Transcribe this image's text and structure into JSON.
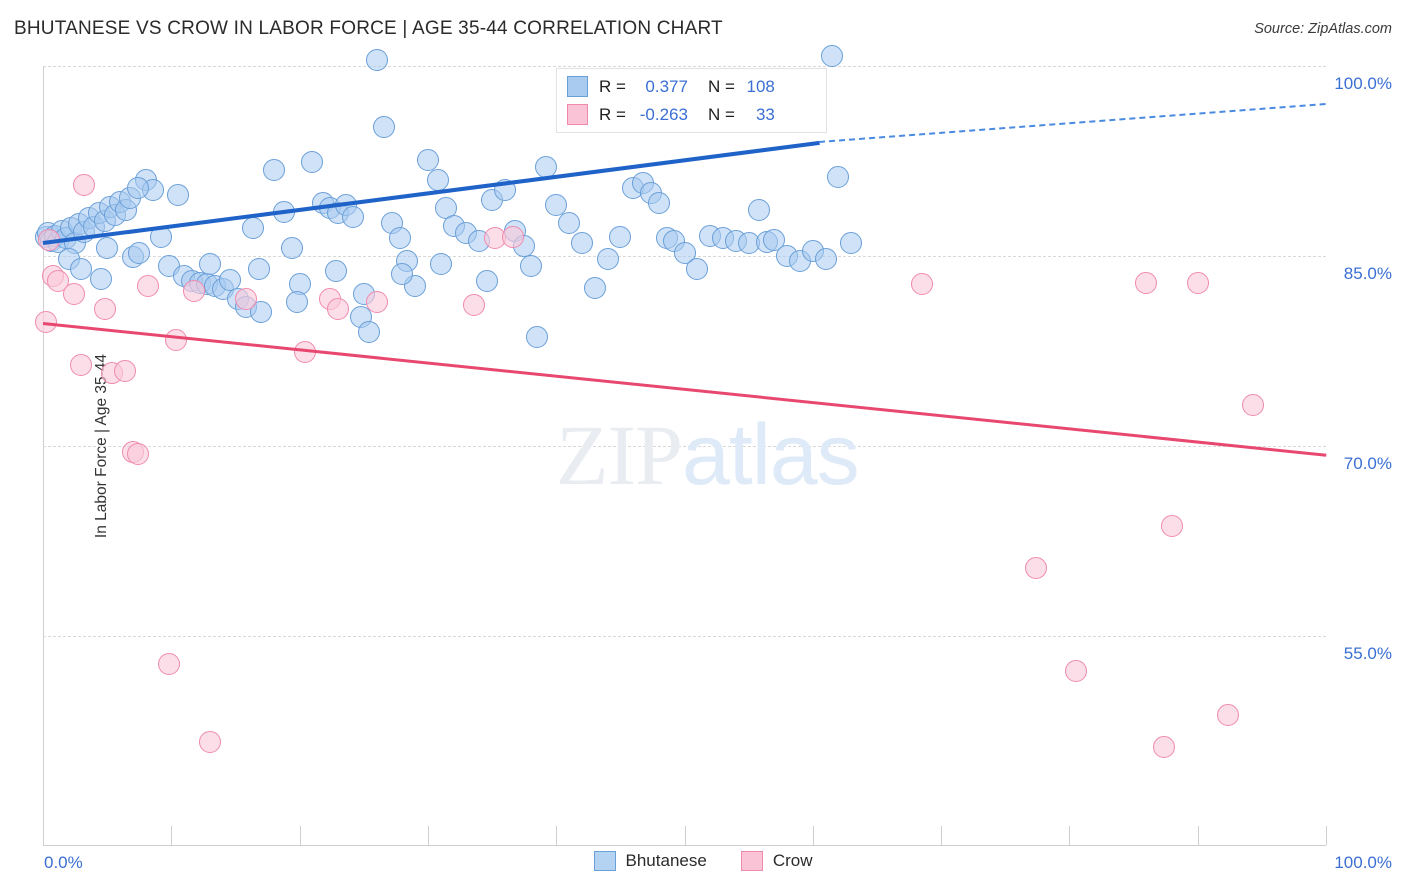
{
  "header": {
    "title": "BHUTANESE VS CROW IN LABOR FORCE | AGE 35-44 CORRELATION CHART",
    "source": "Source: ZipAtlas.com"
  },
  "watermark": {
    "part1": "ZIP",
    "part2": "atlas"
  },
  "stats": {
    "rows": [
      {
        "series": "Bhutanese",
        "color": "#a9cbef",
        "r_label": "R =",
        "r_value": "0.377",
        "n_label": "N =",
        "n_value": "108"
      },
      {
        "series": "Crow",
        "color": "#fbc4d6",
        "r_label": "R =",
        "r_value": "-0.263",
        "n_label": "N =",
        "n_value": "33"
      }
    ]
  },
  "legend": {
    "items": [
      {
        "label": "Bhutanese",
        "color": "#b4d2f2"
      },
      {
        "label": "Crow",
        "color": "#fbc4d6"
      }
    ]
  },
  "chart_data": {
    "type": "scatter",
    "title": "BHUTANESE VS CROW IN LABOR FORCE | AGE 35-44 CORRELATION CHART",
    "xlabel": "",
    "ylabel": "In Labor Force | Age 35-44",
    "xlim": [
      0,
      100
    ],
    "ylim": [
      38.5,
      100
    ],
    "grid": true,
    "legend_position": "bottom-center",
    "x_ticks": [
      "0.0%",
      "100.0%"
    ],
    "x_tick_values": [
      0,
      100
    ],
    "y_ticks": [
      "100.0%",
      "85.0%",
      "70.0%",
      "55.0%"
    ],
    "y_tick_values": [
      100,
      85,
      70,
      55
    ],
    "series": [
      {
        "name": "Bhutanese",
        "color": "#a9cbef",
        "edge": "#6a9fd8",
        "r": 0.377,
        "n": 108,
        "trend": {
          "x0": 0,
          "y0": 86.2,
          "x1": 60.5,
          "y1": 94.1,
          "solid_to": 60.5,
          "dashed_to": 100,
          "y_at_100": 97.1
        },
        "points": [
          [
            0.2,
            86.5
          ],
          [
            0.4,
            86.8
          ],
          [
            0.6,
            86.2
          ],
          [
            0.9,
            86.6
          ],
          [
            1.2,
            86.1
          ],
          [
            1.5,
            87.0
          ],
          [
            1.8,
            86.4
          ],
          [
            2.2,
            87.2
          ],
          [
            2.5,
            86.0
          ],
          [
            2.8,
            87.5
          ],
          [
            3.2,
            86.9
          ],
          [
            3.6,
            88.0
          ],
          [
            4.0,
            87.3
          ],
          [
            4.4,
            88.4
          ],
          [
            4.8,
            87.8
          ],
          [
            5.2,
            88.9
          ],
          [
            5.6,
            88.2
          ],
          [
            6.0,
            89.3
          ],
          [
            6.5,
            88.6
          ],
          [
            7.0,
            84.9
          ],
          [
            7.5,
            85.2
          ],
          [
            2.0,
            84.8
          ],
          [
            3.0,
            84.0
          ],
          [
            4.5,
            83.2
          ],
          [
            8.0,
            91.0
          ],
          [
            8.6,
            90.2
          ],
          [
            9.2,
            86.5
          ],
          [
            9.8,
            84.2
          ],
          [
            10.5,
            89.8
          ],
          [
            11.0,
            83.4
          ],
          [
            11.6,
            83.0
          ],
          [
            12.2,
            82.9
          ],
          [
            12.8,
            82.8
          ],
          [
            13.4,
            82.6
          ],
          [
            14.0,
            82.4
          ],
          [
            14.6,
            83.1
          ],
          [
            15.2,
            81.6
          ],
          [
            15.8,
            81.0
          ],
          [
            16.4,
            87.2
          ],
          [
            17.0,
            80.6
          ],
          [
            18.0,
            91.8
          ],
          [
            18.8,
            88.5
          ],
          [
            19.4,
            85.6
          ],
          [
            20.0,
            82.8
          ],
          [
            21.0,
            92.4
          ],
          [
            21.8,
            89.2
          ],
          [
            22.4,
            88.8
          ],
          [
            23.0,
            88.4
          ],
          [
            23.6,
            89.0
          ],
          [
            24.2,
            88.1
          ],
          [
            24.8,
            80.2
          ],
          [
            25.4,
            79.0
          ],
          [
            26.0,
            100.5
          ],
          [
            26.6,
            95.2
          ],
          [
            27.2,
            87.6
          ],
          [
            27.8,
            86.4
          ],
          [
            28.4,
            84.6
          ],
          [
            29.0,
            82.6
          ],
          [
            30.0,
            92.6
          ],
          [
            30.8,
            91.0
          ],
          [
            31.4,
            88.8
          ],
          [
            32.0,
            87.4
          ],
          [
            33.0,
            86.8
          ],
          [
            34.0,
            86.2
          ],
          [
            35.0,
            89.4
          ],
          [
            36.0,
            90.2
          ],
          [
            36.8,
            87.0
          ],
          [
            37.5,
            85.8
          ],
          [
            38.0,
            84.2
          ],
          [
            38.5,
            78.6
          ],
          [
            39.2,
            92.0
          ],
          [
            40.0,
            89.0
          ],
          [
            41.0,
            87.6
          ],
          [
            42.0,
            86.0
          ],
          [
            43.0,
            82.5
          ],
          [
            44.0,
            84.8
          ],
          [
            45.0,
            86.5
          ],
          [
            46.0,
            90.4
          ],
          [
            46.8,
            90.8
          ],
          [
            47.4,
            90.0
          ],
          [
            48.0,
            89.2
          ],
          [
            48.6,
            86.4
          ],
          [
            49.2,
            86.2
          ],
          [
            50.0,
            85.2
          ],
          [
            51.0,
            84.0
          ],
          [
            52.0,
            86.6
          ],
          [
            53.0,
            86.4
          ],
          [
            54.0,
            86.2
          ],
          [
            55.0,
            86.0
          ],
          [
            55.8,
            88.6
          ],
          [
            56.4,
            86.1
          ],
          [
            57.0,
            86.3
          ],
          [
            58.0,
            85.0
          ],
          [
            59.0,
            84.6
          ],
          [
            60.0,
            85.4
          ],
          [
            61.0,
            84.8
          ],
          [
            62.0,
            91.2
          ],
          [
            63.0,
            86.0
          ],
          [
            6.8,
            89.6
          ],
          [
            7.4,
            90.4
          ],
          [
            13.0,
            84.4
          ],
          [
            16.8,
            84.0
          ],
          [
            19.8,
            81.4
          ],
          [
            22.8,
            83.8
          ],
          [
            25.0,
            82.0
          ],
          [
            28.0,
            83.6
          ],
          [
            31.0,
            84.4
          ],
          [
            34.6,
            83.0
          ],
          [
            61.5,
            100.8
          ],
          [
            5.0,
            85.6
          ]
        ]
      },
      {
        "name": "Crow",
        "color": "#fbc4d6",
        "edge": "#ef8aae",
        "r": -0.263,
        "n": 33,
        "trend": {
          "x0": 0,
          "y0": 79.8,
          "x1": 100,
          "y1": 69.4
        },
        "points": [
          [
            0.2,
            79.8
          ],
          [
            0.5,
            86.3
          ],
          [
            0.8,
            83.4
          ],
          [
            1.2,
            83.0
          ],
          [
            2.4,
            82.0
          ],
          [
            3.2,
            90.6
          ],
          [
            4.8,
            80.8
          ],
          [
            5.4,
            75.8
          ],
          [
            6.4,
            75.9
          ],
          [
            3.0,
            76.4
          ],
          [
            7.0,
            69.5
          ],
          [
            7.4,
            69.4
          ],
          [
            8.2,
            82.6
          ],
          [
            10.4,
            78.4
          ],
          [
            11.8,
            82.2
          ],
          [
            9.8,
            52.8
          ],
          [
            13.0,
            46.6
          ],
          [
            15.8,
            81.6
          ],
          [
            20.4,
            77.4
          ],
          [
            22.4,
            81.6
          ],
          [
            23.0,
            80.8
          ],
          [
            26.0,
            81.4
          ],
          [
            33.6,
            81.1
          ],
          [
            35.2,
            86.4
          ],
          [
            36.6,
            86.5
          ],
          [
            68.5,
            82.8
          ],
          [
            86.0,
            82.9
          ],
          [
            90.0,
            82.9
          ],
          [
            94.3,
            73.2
          ],
          [
            88.0,
            63.7
          ],
          [
            77.4,
            60.4
          ],
          [
            80.5,
            52.2
          ],
          [
            92.4,
            48.8
          ],
          [
            87.4,
            46.2
          ]
        ]
      }
    ]
  },
  "axis": {
    "y_title": "In Labor Force | Age 35-44",
    "x_left": "0.0%",
    "x_right": "100.0%"
  }
}
